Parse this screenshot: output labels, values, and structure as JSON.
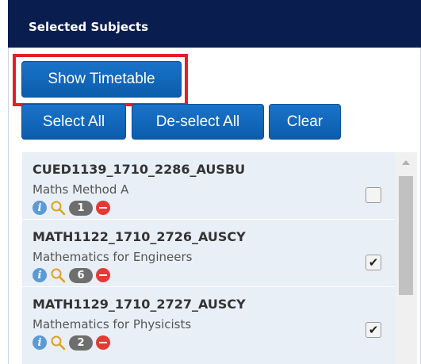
{
  "panel": {
    "title": "Selected Subjects"
  },
  "buttons": {
    "show_timetable": "Show Timetable",
    "select_all": "Select All",
    "deselect_all": "De-select All",
    "clear": "Clear"
  },
  "subjects": [
    {
      "code": "CUED1139_1710_2286_AUSBU",
      "name": "Maths Method A",
      "count": "1",
      "checked": false
    },
    {
      "code": "MATH1122_1710_2726_AUSCY",
      "name": "Mathematics for Engineers",
      "count": "6",
      "checked": true
    },
    {
      "code": "MATH1129_1710_2727_AUSCY",
      "name": "Mathematics for Physicists",
      "count": "2",
      "checked": true
    }
  ],
  "icons": {
    "info": "info-icon",
    "magnifier": "magnifier-icon",
    "remove": "remove-icon",
    "check": "checkmark-icon"
  },
  "colors": {
    "header_bg": "#0a1d4f",
    "button_bg": "#1a73c8",
    "highlight_border": "#e41e26",
    "list_bg": "#e9eff7"
  }
}
